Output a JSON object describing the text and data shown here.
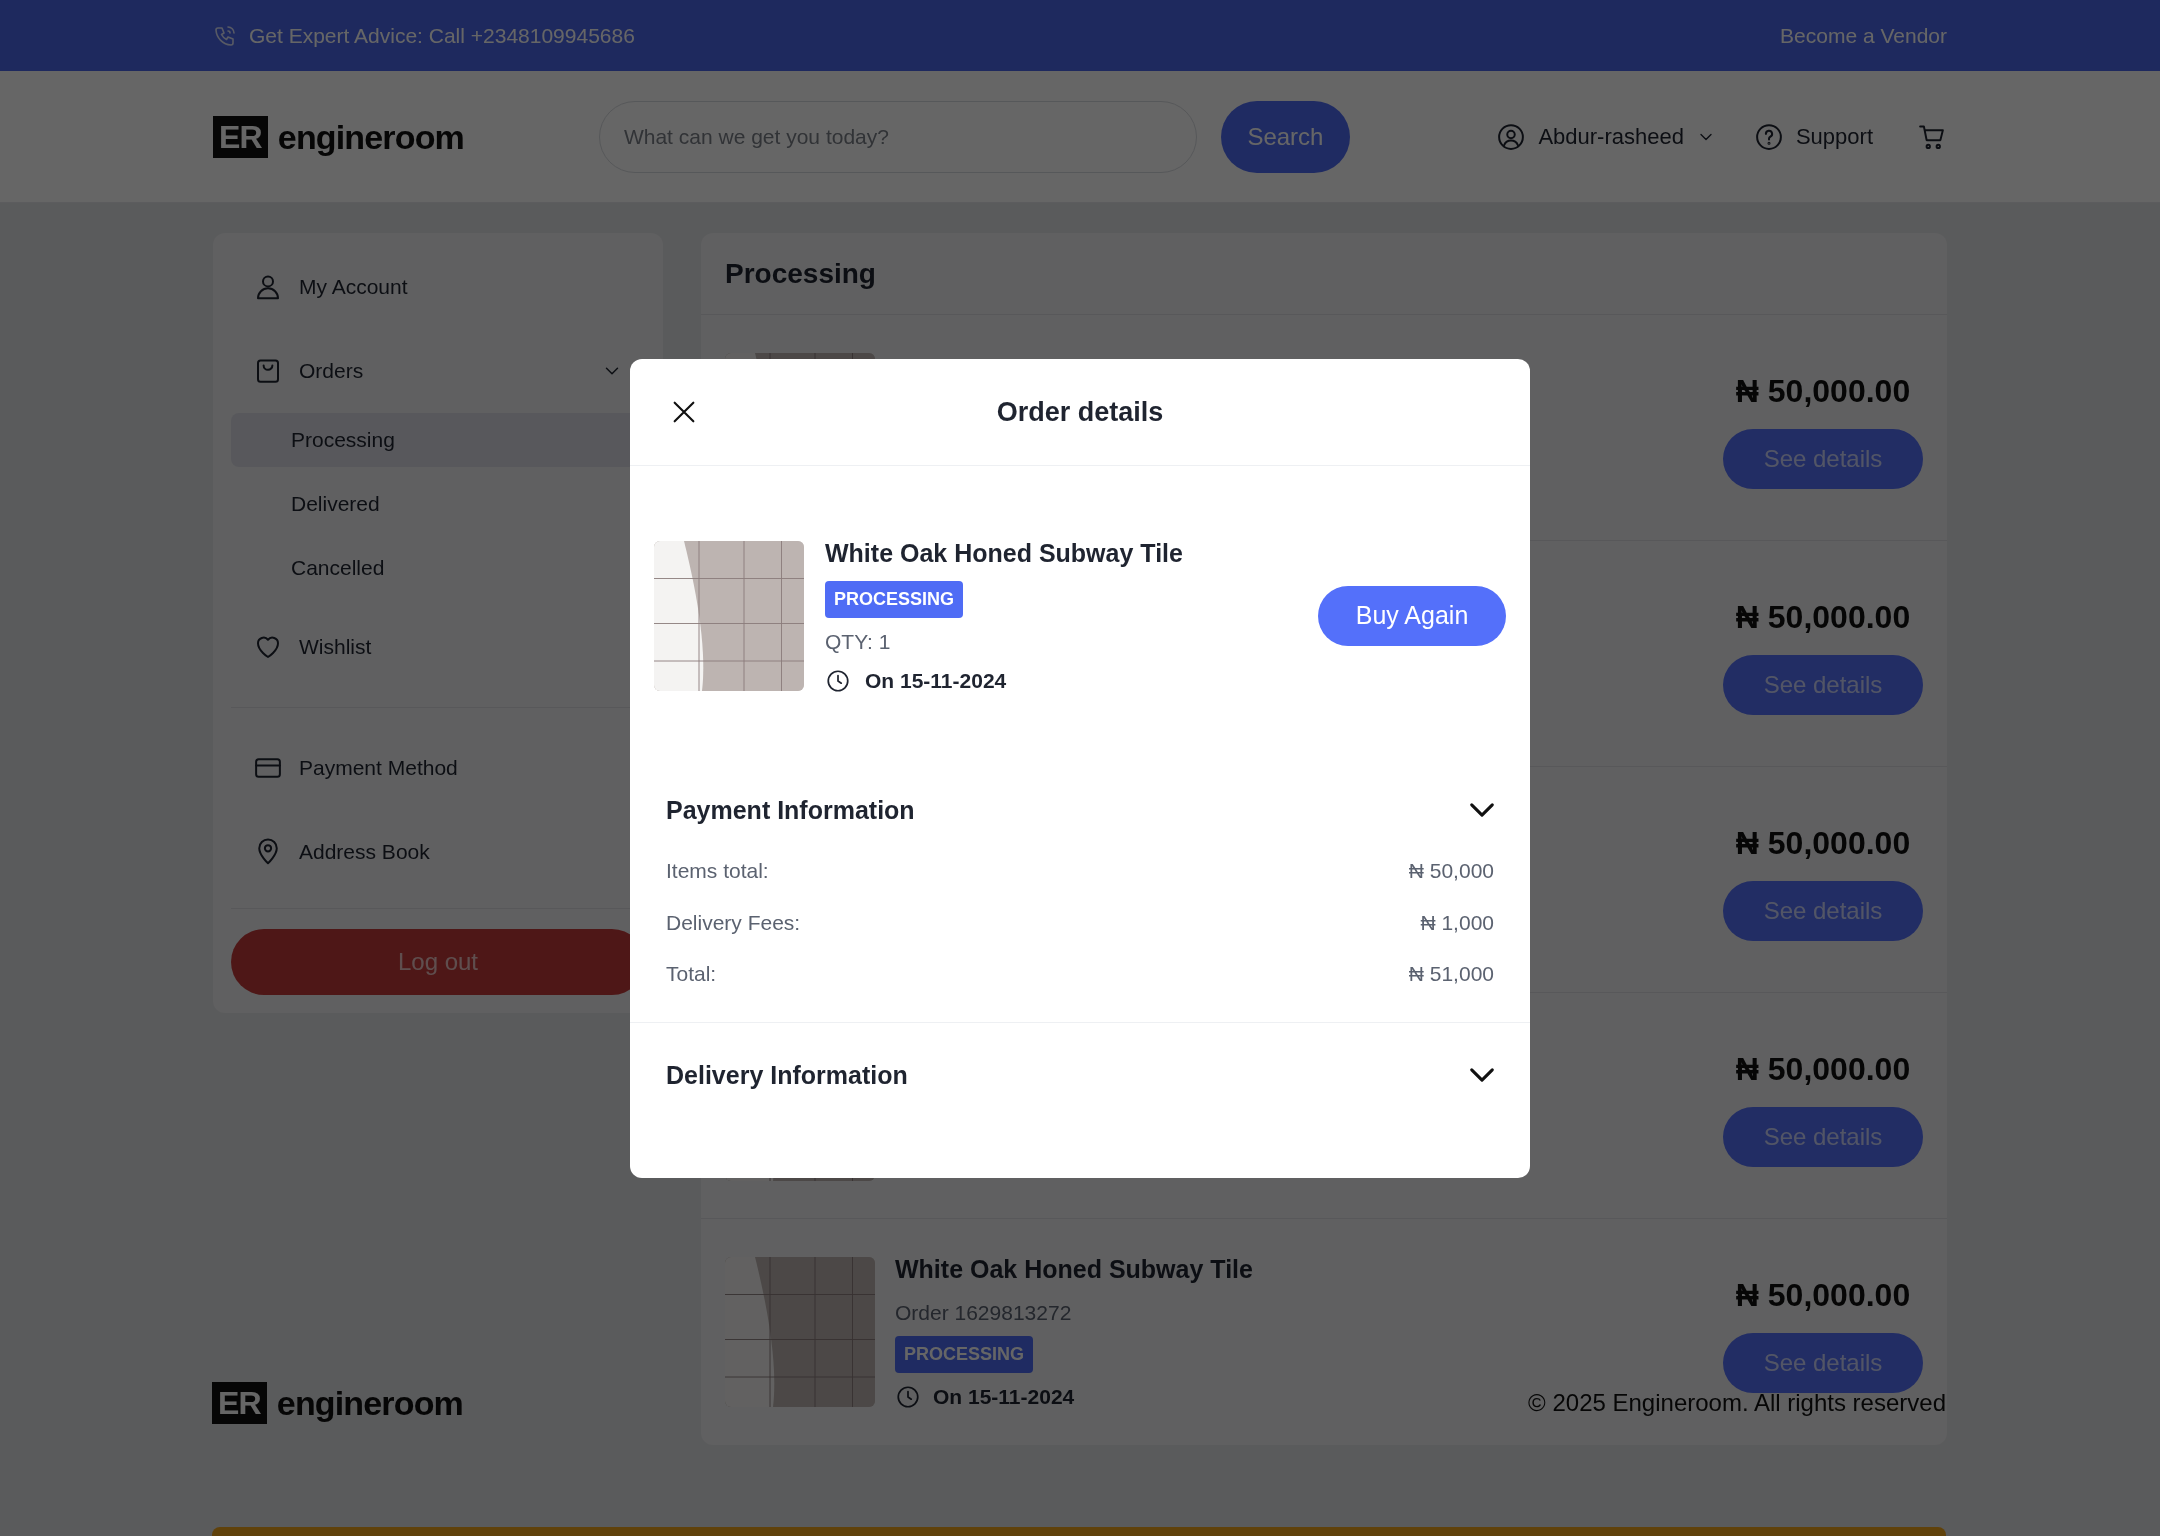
{
  "top_bar": {
    "advice": "Get Expert Advice: Call +2348109945686",
    "vendor_link": "Become a Vendor"
  },
  "header": {
    "logo": {
      "mark": "ER",
      "name": "engineroom"
    },
    "search": {
      "placeholder": "What can we get you today?",
      "button": "Search"
    },
    "user": "Abdur-rasheed",
    "support": "Support"
  },
  "sidebar": {
    "groups": [
      [
        {
          "label": "My Account"
        },
        {
          "label": "Orders",
          "expanded": true,
          "children": [
            {
              "label": "Processing",
              "selected": true
            },
            {
              "label": "Delivered",
              "selected": false
            },
            {
              "label": "Cancelled",
              "selected": false
            }
          ]
        },
        {
          "label": "Wishlist"
        }
      ],
      [
        {
          "label": "Payment Method"
        },
        {
          "label": "Address Book"
        }
      ]
    ],
    "logout": "Log out"
  },
  "orders": {
    "title": "Processing",
    "rows": [
      {
        "price": "₦ 50,000.00",
        "button": "See details"
      },
      {
        "price": "₦ 50,000.00",
        "button": "See details"
      },
      {
        "price": "₦ 50,000.00",
        "button": "See details"
      },
      {
        "price": "₦ 50,000.00",
        "button": "See details"
      },
      {
        "title": "White Oak Honed Subway Tile",
        "order_no": "Order 1629813272",
        "status": "PROCESSING",
        "date": "On 15-11-2024",
        "price": "₦ 50,000.00",
        "button": "See details"
      }
    ]
  },
  "modal": {
    "title": "Order details",
    "product": {
      "title": "White Oak Honed Subway Tile",
      "status": "PROCESSING",
      "qty": "QTY: 1",
      "date": "On 15-11-2024",
      "button": "Buy Again"
    },
    "sections": [
      {
        "title": "Payment Information",
        "rows": [
          {
            "label": "Items total:",
            "value": "₦ 50,000"
          },
          {
            "label": "Delivery Fees:",
            "value": "₦ 1,000"
          },
          {
            "label": "Total:",
            "value": "₦ 51,000"
          }
        ]
      },
      {
        "title": "Delivery Information"
      }
    ]
  },
  "footer": {
    "logo": {
      "mark": "ER",
      "name": "engineroom"
    },
    "copyright": "© 2025 Engineroom. All rights reserved"
  }
}
